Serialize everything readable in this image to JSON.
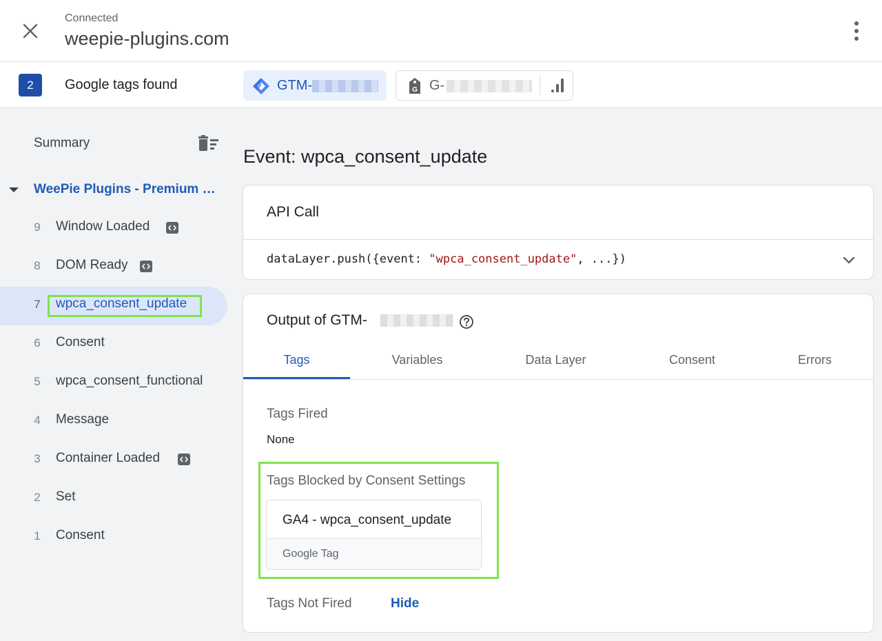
{
  "header": {
    "status": "Connected",
    "site": "weepie-plugins.com",
    "close_icon": "close-icon",
    "more_icon": "more-vert-icon"
  },
  "tags_bar": {
    "count": "2",
    "label": "Google tags found",
    "gtm_prefix": "GTM-",
    "ga_prefix": "G-"
  },
  "sidebar": {
    "summary": "Summary",
    "container": "WeePie Plugins - Premium WP plugins",
    "events": [
      {
        "num": "9",
        "label": "Window Loaded",
        "badge": true
      },
      {
        "num": "8",
        "label": "DOM Ready",
        "badge": true
      },
      {
        "num": "7",
        "label": "wpca_consent_update",
        "badge": false,
        "selected": true
      },
      {
        "num": "6",
        "label": "Consent",
        "badge": false
      },
      {
        "num": "5",
        "label": "wpca_consent_functional",
        "badge": false
      },
      {
        "num": "4",
        "label": "Message",
        "badge": false
      },
      {
        "num": "3",
        "label": "Container Loaded",
        "badge": true
      },
      {
        "num": "2",
        "label": "Set",
        "badge": false
      },
      {
        "num": "1",
        "label": "Consent",
        "badge": false
      }
    ]
  },
  "main": {
    "title": "Event: wpca_consent_update",
    "api": {
      "title": "API Call",
      "code_prefix": "dataLayer.push({event: ",
      "code_string": "\"wpca_consent_update\"",
      "code_suffix": ", ...})"
    },
    "output": {
      "title": "Output of GTM-",
      "tabs": [
        "Tags",
        "Variables",
        "Data Layer",
        "Consent",
        "Errors"
      ],
      "active_tab": "Tags",
      "tags_fired_title": "Tags Fired",
      "tags_fired_value": "None",
      "blocked_title": "Tags Blocked by Consent Settings",
      "blocked_tag": {
        "name": "GA4 - wpca_consent_update",
        "type": "Google Tag"
      },
      "not_fired_title": "Tags Not Fired",
      "hide_label": "Hide"
    }
  },
  "colors": {
    "accent": "#1f5bb8",
    "badge_bg": "#1f4ea8",
    "selected_bg": "#dde6f8",
    "highlight": "#7de34e"
  }
}
